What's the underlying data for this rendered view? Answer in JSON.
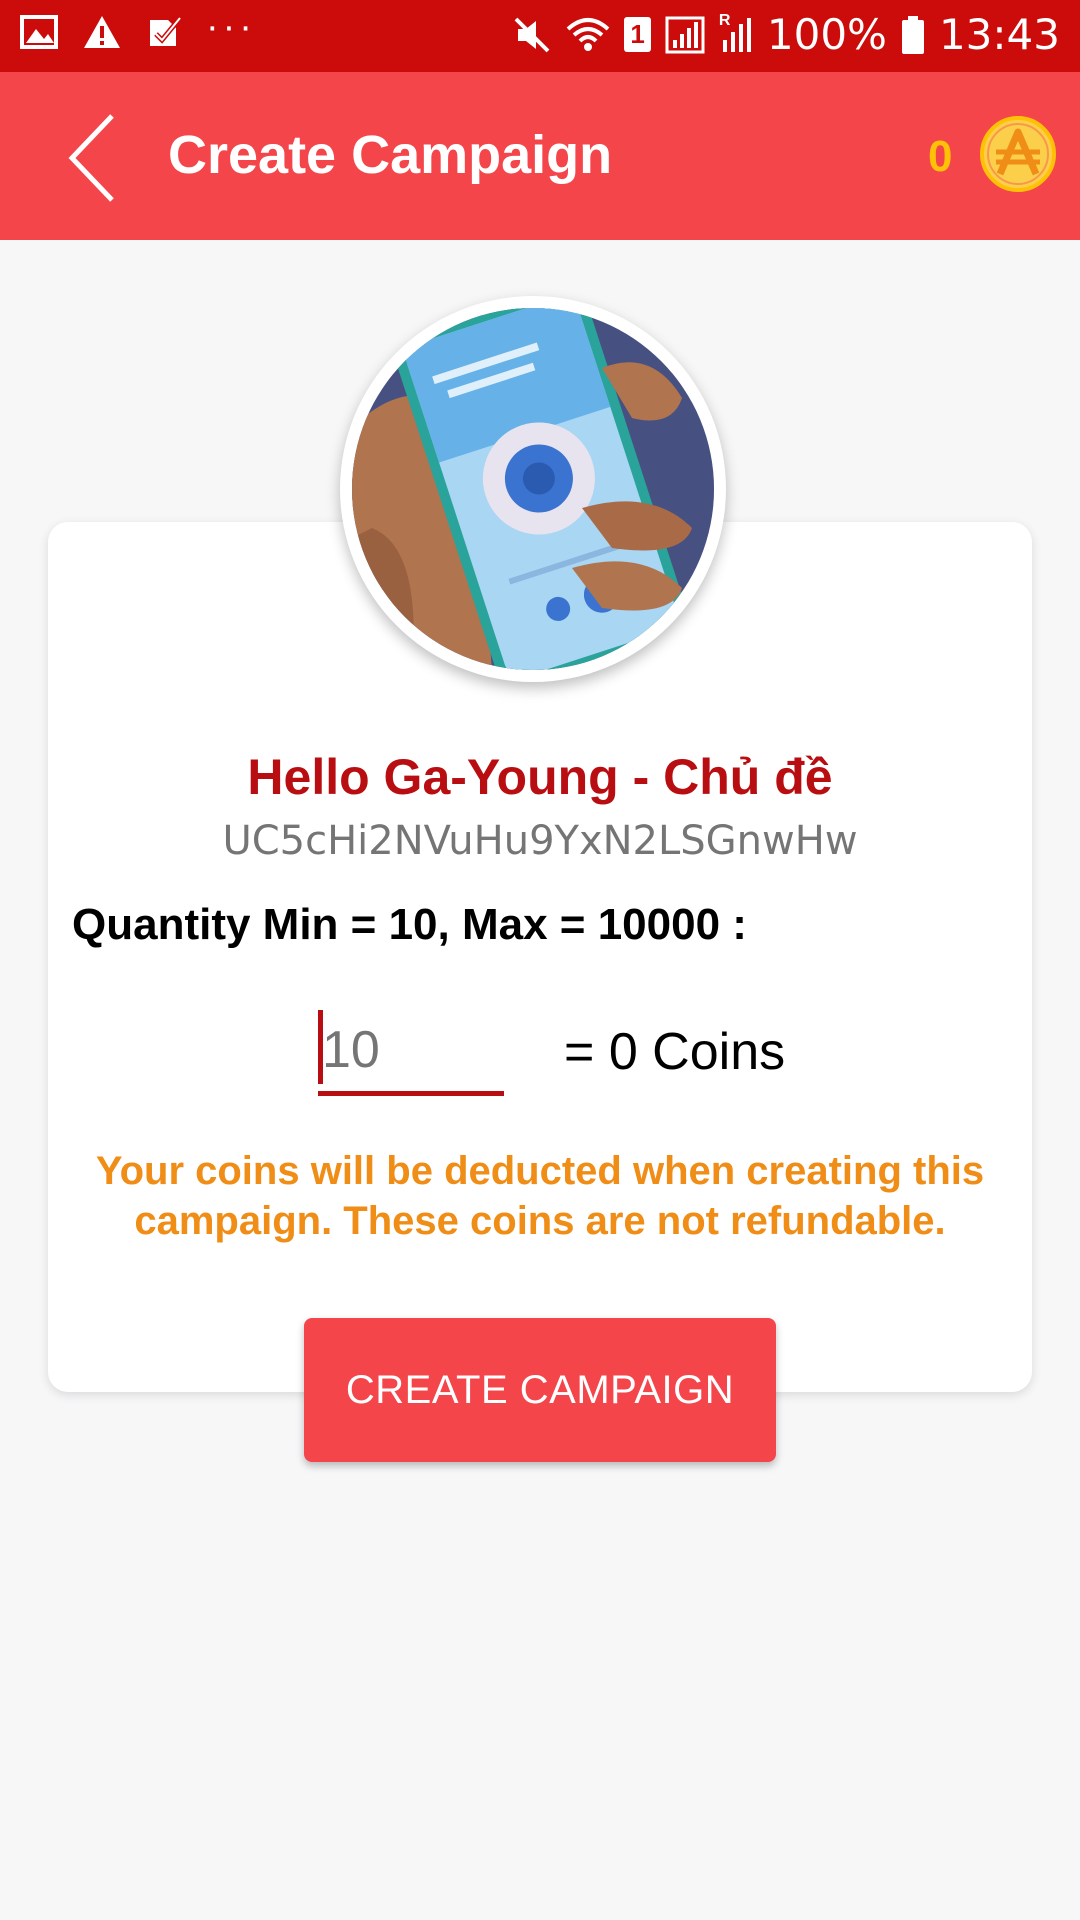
{
  "status_bar": {
    "battery_text": "100%",
    "time": "13:43",
    "dots": "···",
    "sim_label": "1",
    "signal_label": "R"
  },
  "app_bar": {
    "title": "Create Campaign",
    "coin_count": "0"
  },
  "video": {
    "title": "Hello Ga-Young - Chủ đề",
    "channel_id": "UC5cHi2NVuHu9YxN2LSGnwHw"
  },
  "form": {
    "quantity_label": "Quantity Min = 10, Max = 10000 :",
    "quantity_placeholder": "10",
    "coins_result": "= 0 Coins",
    "warning": "Your coins will be deducted when creating this campaign. These coins are not refundable.",
    "create_button": "CREATE CAMPAIGN"
  },
  "colors": {
    "status_bar": "#cc0b0b",
    "app_bar": "#f4454a",
    "title_red": "#b80e12",
    "coin_yellow": "#ffc107",
    "warning_orange": "#ef8d17"
  }
}
